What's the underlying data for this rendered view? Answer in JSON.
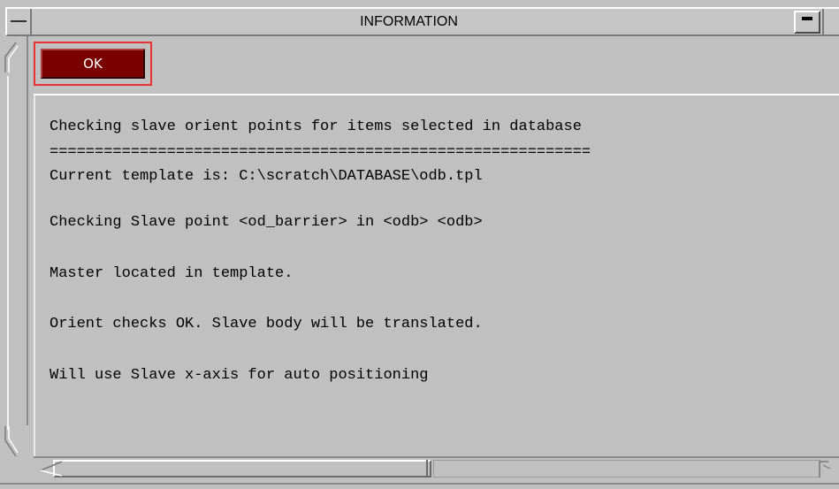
{
  "window": {
    "title": "INFORMATION"
  },
  "actions": {
    "ok_label": "OK"
  },
  "output": {
    "lines": [
      "Checking slave orient points for items selected in database",
      "============================================================",
      "Current template is: C:\\scratch\\DATABASE\\odb.tpl",
      "Checking Slave point <od_barrier> in <odb> <odb>",
      "Master located in template.",
      "Orient checks OK. Slave body will be translated.",
      "Will use Slave x-axis for auto positioning"
    ]
  },
  "colors": {
    "background": "#c0c0c0",
    "ok_button": "#7a0000",
    "focus_ring": "#e83232"
  }
}
